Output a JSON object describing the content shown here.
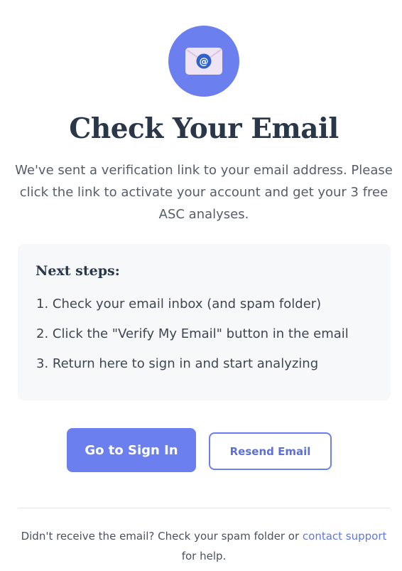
{
  "header": {
    "icon": "envelope-at-icon",
    "title": "Check Your Email",
    "message": "We've sent a verification link to your email address. Please click the link to activate your account and get your 3 free ASC analyses."
  },
  "next_steps": {
    "heading": "Next steps:",
    "items": [
      "1. Check your email inbox (and spam folder)",
      "2. Click the \"Verify My Email\" button in the email",
      "3. Return here to sign in and start analyzing"
    ]
  },
  "actions": {
    "primary_label": "Go to Sign In",
    "secondary_label": "Resend Email"
  },
  "footer": {
    "prefix": "Didn't receive the email? Check your spam folder or ",
    "link_label": "contact support",
    "suffix": " for help."
  },
  "colors": {
    "accent": "#6b80ee",
    "heading": "#2a3749",
    "body_text": "#555d68",
    "card_background": "#f7f8fa",
    "link": "#6077e0"
  }
}
